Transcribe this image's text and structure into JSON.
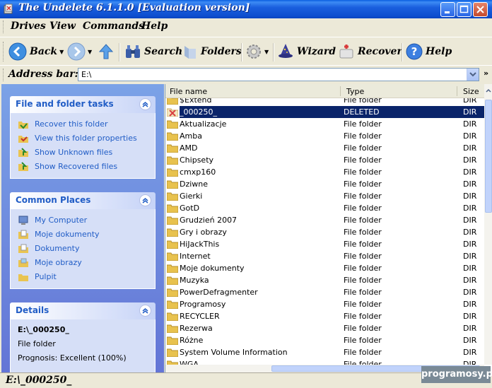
{
  "window": {
    "title": "The Undelete 6.1.1.0 [Evaluation version]"
  },
  "menu": {
    "items": [
      "Drives",
      "View",
      "Commands",
      "Help"
    ]
  },
  "toolbar": {
    "back": "Back",
    "search": "Search",
    "folders": "Folders",
    "wizard": "Wizard",
    "recover": "Recover",
    "help": "Help"
  },
  "address": {
    "label": "Address bar:",
    "value": "E:\\"
  },
  "panels": {
    "tasks": {
      "title": "File and folder tasks",
      "items": [
        "Recover this folder",
        "View this folder properties",
        "Show Unknown files",
        "Show Recovered files"
      ]
    },
    "places": {
      "title": "Common Places",
      "items": [
        "My Computer",
        "Moje dokumenty",
        "Dokumenty",
        "Moje obrazy",
        "Pulpit"
      ]
    },
    "details": {
      "title": "Details",
      "name": "E:\\_000250_",
      "type": "File folder",
      "prognosis": "Prognosis: Excellent (100%)"
    }
  },
  "list": {
    "columns": {
      "name": "File name",
      "type": "Type",
      "size": "Size"
    },
    "partial_top": {
      "name": "$Extend",
      "type": "File folder",
      "size": "DIR"
    },
    "rows": [
      {
        "name": "_000250_",
        "type": "DELETED",
        "size": "DIR",
        "deleted": true,
        "selected": true
      },
      {
        "name": "Aktualizacje",
        "type": "File folder",
        "size": "DIR"
      },
      {
        "name": "Amba",
        "type": "File folder",
        "size": "DIR"
      },
      {
        "name": "AMD",
        "type": "File folder",
        "size": "DIR"
      },
      {
        "name": "Chipsety",
        "type": "File folder",
        "size": "DIR"
      },
      {
        "name": "cmxp160",
        "type": "File folder",
        "size": "DIR"
      },
      {
        "name": "Dziwne",
        "type": "File folder",
        "size": "DIR"
      },
      {
        "name": "Gierki",
        "type": "File folder",
        "size": "DIR"
      },
      {
        "name": "GotD",
        "type": "File folder",
        "size": "DIR"
      },
      {
        "name": "Grudzień 2007",
        "type": "File folder",
        "size": "DIR"
      },
      {
        "name": "Gry i obrazy",
        "type": "File folder",
        "size": "DIR"
      },
      {
        "name": "HiJackThis",
        "type": "File folder",
        "size": "DIR"
      },
      {
        "name": "Internet",
        "type": "File folder",
        "size": "DIR"
      },
      {
        "name": "Moje dokumenty",
        "type": "File folder",
        "size": "DIR"
      },
      {
        "name": "Muzyka",
        "type": "File folder",
        "size": "DIR"
      },
      {
        "name": "PowerDefragmenter",
        "type": "File folder",
        "size": "DIR"
      },
      {
        "name": "Programosy",
        "type": "File folder",
        "size": "DIR"
      },
      {
        "name": "RECYCLER",
        "type": "File folder",
        "size": "DIR"
      },
      {
        "name": "Rezerwa",
        "type": "File folder",
        "size": "DIR"
      },
      {
        "name": "Różne",
        "type": "File folder",
        "size": "DIR"
      },
      {
        "name": "System Volume Information",
        "type": "File folder",
        "size": "DIR"
      }
    ],
    "partial_bottom": {
      "name": "WGA",
      "type": "File folder",
      "size": "DIR"
    }
  },
  "status": {
    "text": "E:\\_000250_"
  },
  "watermark": "programosy.pl",
  "colors": {
    "selection": "#0a246a",
    "link": "#215dc6",
    "titlebar": "#0e4fd0",
    "panel_bg": "#7ba2e7"
  }
}
